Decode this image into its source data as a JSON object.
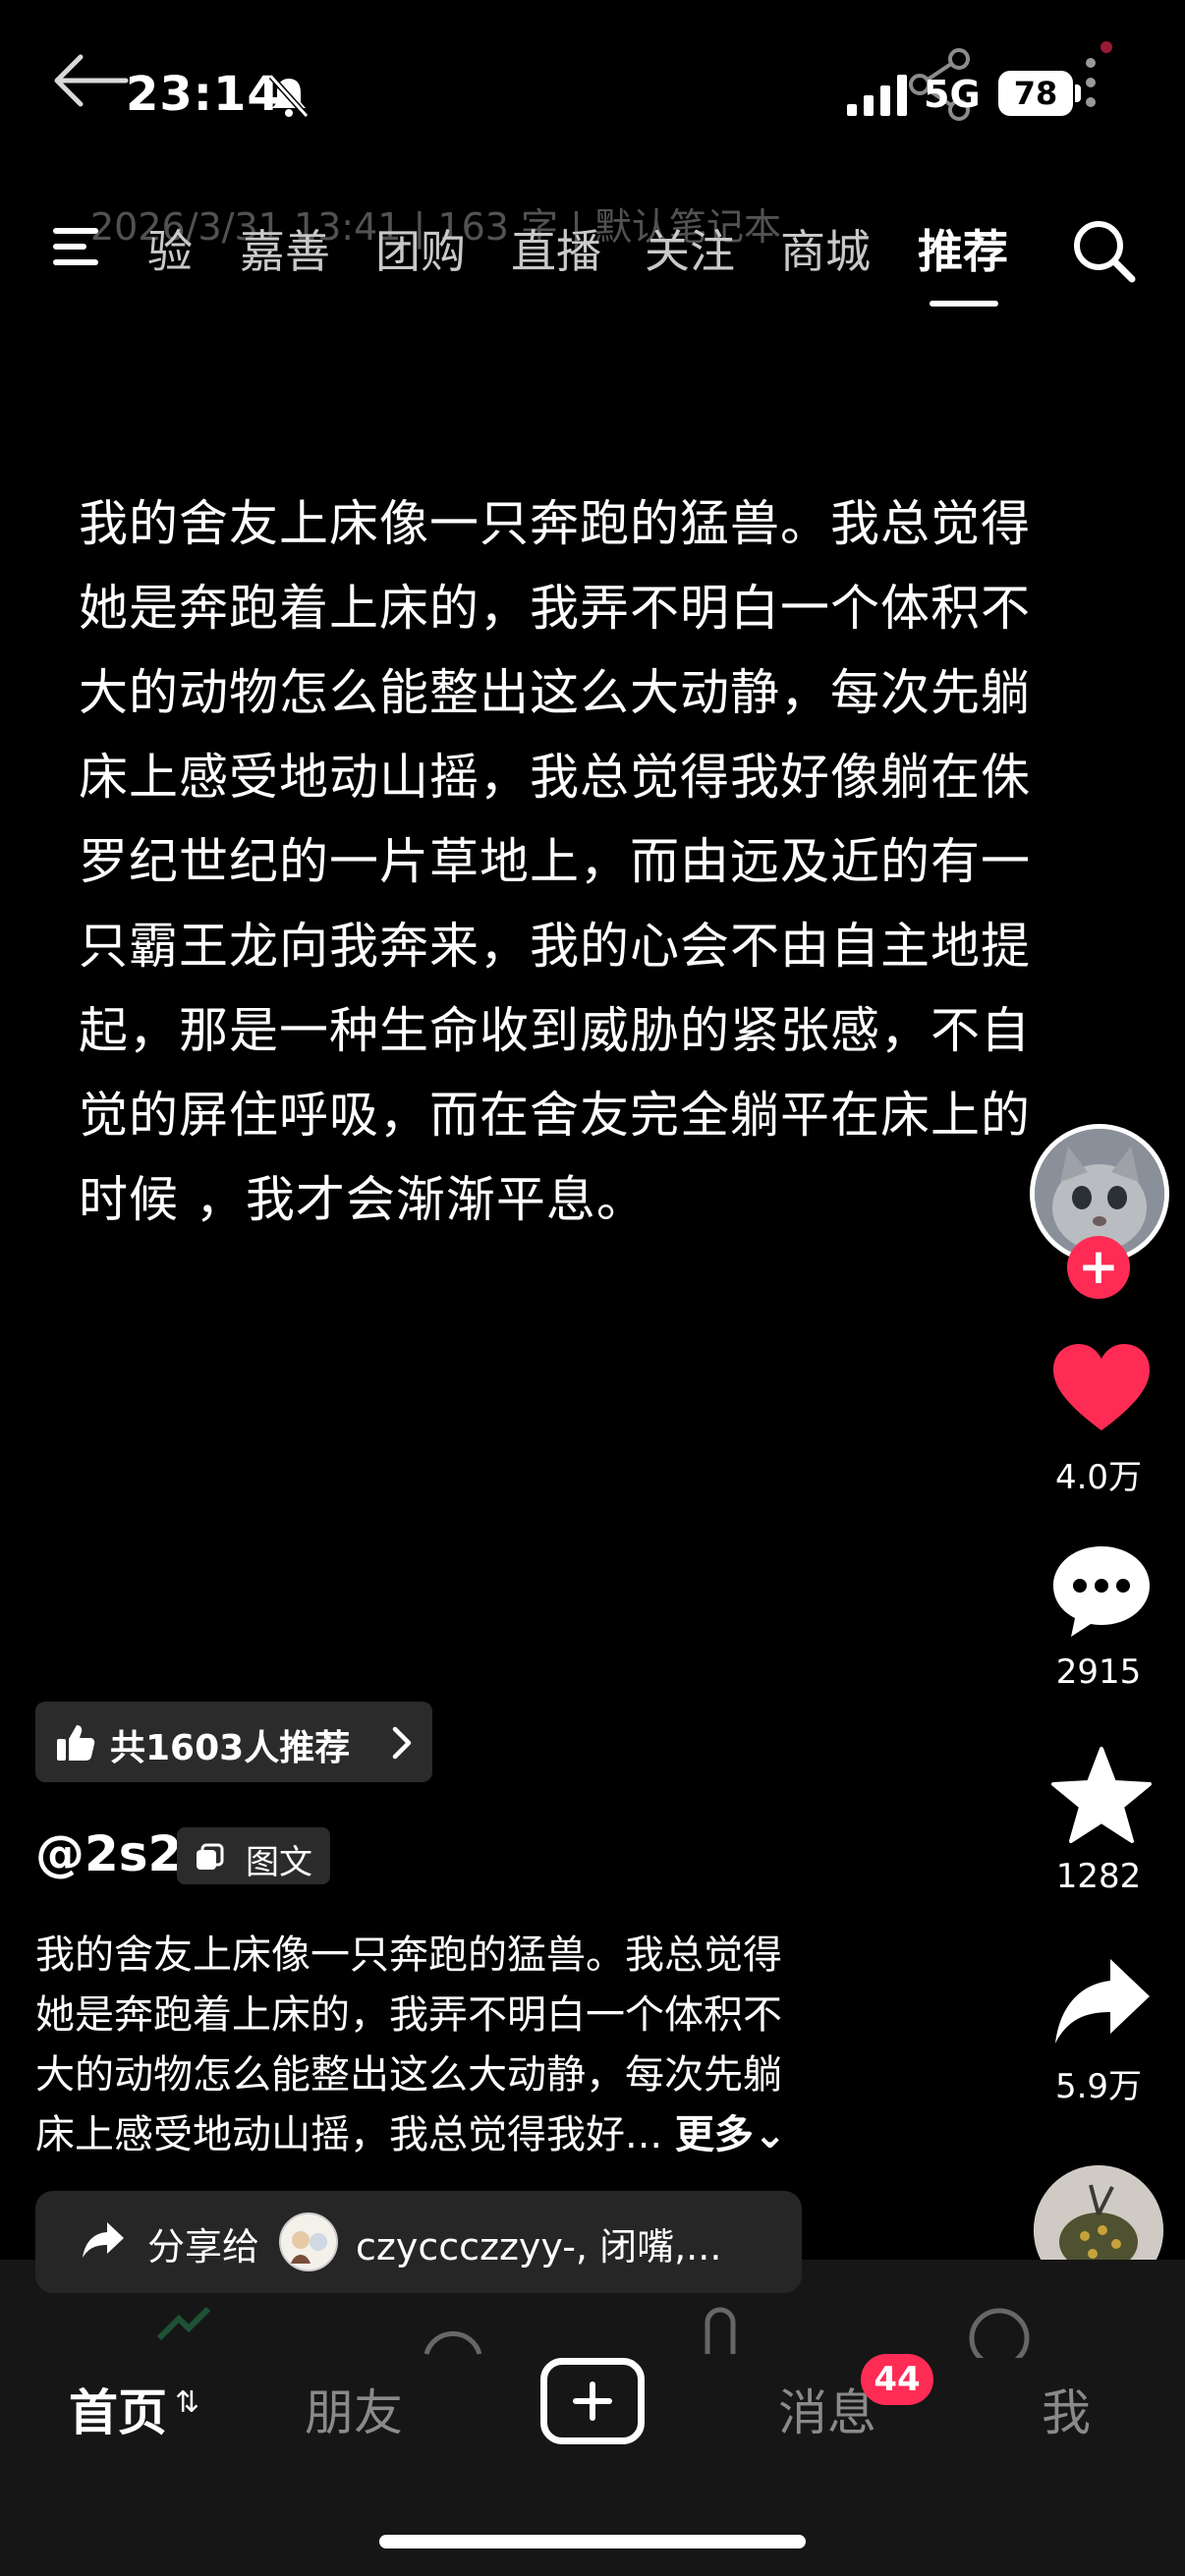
{
  "status_bar": {
    "time": "23:14",
    "network": "5G",
    "battery": "78"
  },
  "note_meta": "2026/3/31 13:41 | 163 字 | 默认笔记本",
  "top_nav": {
    "tabs": [
      "验",
      "嘉善",
      "团购",
      "直播",
      "关注",
      "商城",
      "推荐"
    ],
    "active_tab": "推荐"
  },
  "post": {
    "body_lines": [
      "我的舍友上床像一只奔跑的猛兽。我总觉得",
      "她是奔跑着上床的，我弄不明白一个体积不",
      "大的动物怎么能整出这么大动静，每次先躺",
      "床上感受地动山摇，我总觉得我好像躺在侏",
      "罗纪世纪的一片草地上，而由远及近的有一",
      "只霸王龙向我奔来，我的心会不由自主地提",
      "起，那是一种生命收到威胁的紧张感，不自",
      "觉的屏住呼吸，而在舍友完全躺平在床上的",
      "时候 ，我才会渐渐平息。"
    ],
    "recommend_label": "共1603人推荐",
    "author": "@2s2",
    "type_badge": "图文",
    "caption_lines": [
      "我的舍友上床像一只奔跑的猛兽。我总觉得",
      "她是奔跑着上床的，我弄不明白一个体积不",
      "大的动物怎么能整出这么大动静，每次先躺",
      "床上感受地动山摇，我总觉得我好..."
    ],
    "more_label": "更多",
    "share_label": "分享给",
    "share_names": "czyccczzyy-, 闭嘴,..."
  },
  "actions": {
    "likes": "4.0万",
    "comments": "2915",
    "favorites": "1282",
    "shares": "5.9万"
  },
  "colors": {
    "accent": "#fe2c55",
    "background": "#000000",
    "chip_bg": "#2b2b2b"
  },
  "bottom_nav": {
    "home": "首页",
    "friends": "朋友",
    "messages": "消息",
    "message_badge": "44",
    "me": "我"
  }
}
